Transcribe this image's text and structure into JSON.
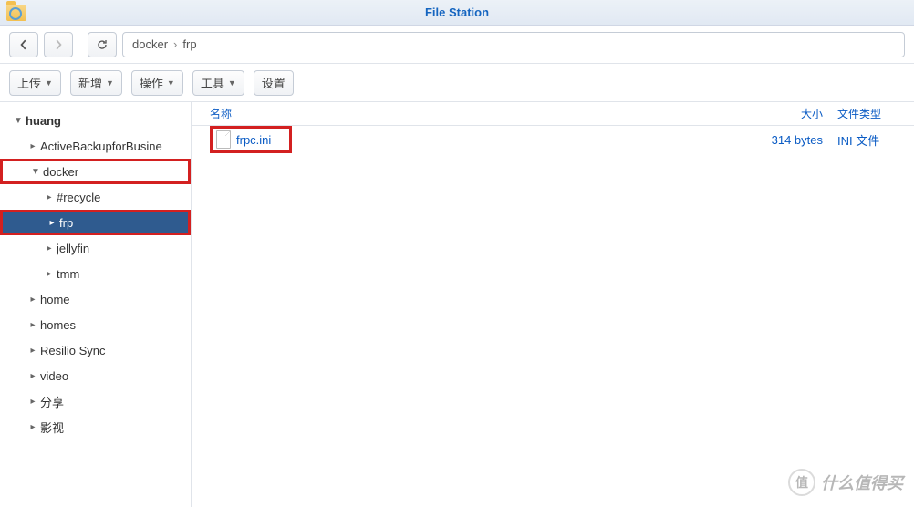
{
  "app": {
    "title": "File Station"
  },
  "breadcrumb": {
    "parts": [
      "docker",
      "frp"
    ]
  },
  "actions": {
    "upload": "上传",
    "new": "新增",
    "action": "操作",
    "tool": "工具",
    "settings": "设置"
  },
  "tree": {
    "root": "huang",
    "items": [
      {
        "label": "ActiveBackupforBusine",
        "depth": 1,
        "expanded": false,
        "selected": false,
        "highlight": false
      },
      {
        "label": "docker",
        "depth": 1,
        "expanded": true,
        "selected": false,
        "highlight": true
      },
      {
        "label": "#recycle",
        "depth": 2,
        "expanded": false,
        "selected": false,
        "highlight": false
      },
      {
        "label": "frp",
        "depth": 2,
        "expanded": false,
        "selected": true,
        "highlight": true
      },
      {
        "label": "jellyfin",
        "depth": 2,
        "expanded": false,
        "selected": false,
        "highlight": false
      },
      {
        "label": "tmm",
        "depth": 2,
        "expanded": false,
        "selected": false,
        "highlight": false
      },
      {
        "label": "home",
        "depth": 1,
        "expanded": false,
        "selected": false,
        "highlight": false
      },
      {
        "label": "homes",
        "depth": 1,
        "expanded": false,
        "selected": false,
        "highlight": false
      },
      {
        "label": "Resilio Sync",
        "depth": 1,
        "expanded": false,
        "selected": false,
        "highlight": false
      },
      {
        "label": "video",
        "depth": 1,
        "expanded": false,
        "selected": false,
        "highlight": false
      },
      {
        "label": "分享",
        "depth": 1,
        "expanded": false,
        "selected": false,
        "highlight": false
      },
      {
        "label": "影视",
        "depth": 1,
        "expanded": false,
        "selected": false,
        "highlight": false
      }
    ]
  },
  "list": {
    "columns": {
      "name": "名称",
      "size": "大小",
      "type": "文件类型"
    },
    "rows": [
      {
        "name": "frpc.ini",
        "size": "314 bytes",
        "type": "INI 文件",
        "highlight": true
      }
    ]
  },
  "watermark": {
    "badge": "值",
    "text": "什么值得买"
  }
}
